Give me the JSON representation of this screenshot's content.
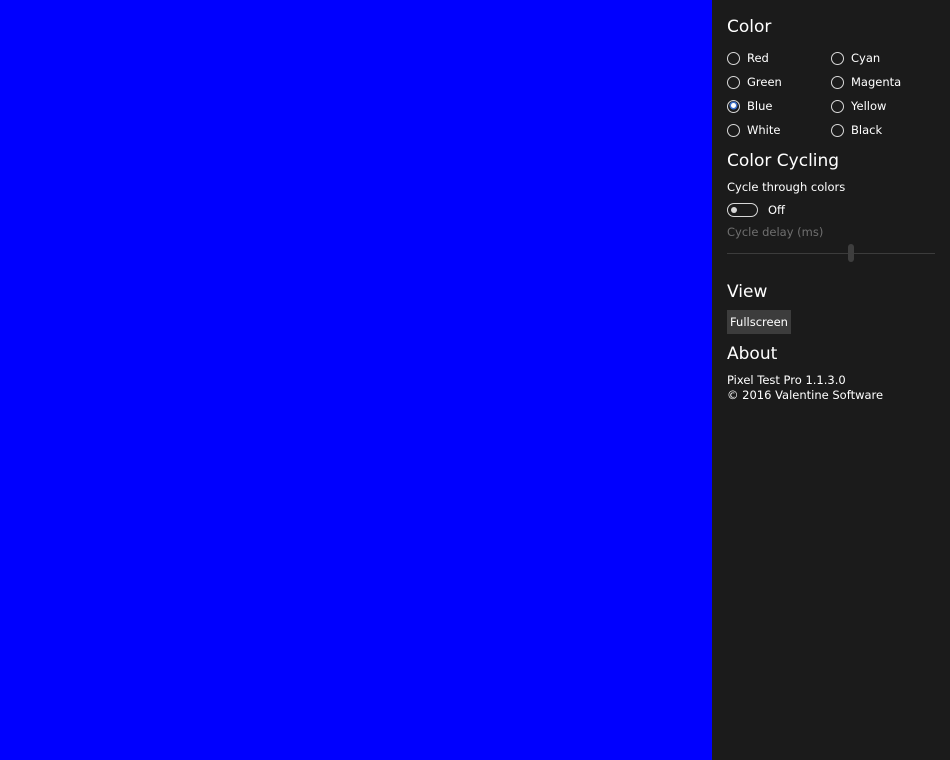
{
  "canvas": {
    "color": "#0000ff"
  },
  "color_section": {
    "heading": "Color",
    "options": [
      "Red",
      "Green",
      "Blue",
      "White",
      "Cyan",
      "Magenta",
      "Yellow",
      "Black"
    ],
    "selected": "Blue"
  },
  "cycling_section": {
    "heading": "Color Cycling",
    "cycle_label": "Cycle through colors",
    "toggle_state": "Off",
    "delay_label": "Cycle delay (ms)"
  },
  "view_section": {
    "heading": "View",
    "fullscreen_label": "Fullscreen"
  },
  "about_section": {
    "heading": "About",
    "version": "Pixel Test Pro 1.1.3.0",
    "copyright": "© 2016 Valentine Software"
  }
}
